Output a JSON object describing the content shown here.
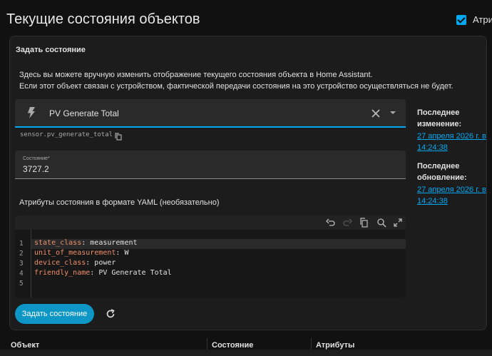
{
  "page": {
    "title": "Текущие состояния объектов",
    "attributes_toggle_label": "Атриб"
  },
  "card": {
    "title": "Задать состояние",
    "description_line1": "Здесь вы можете вручную изменить отображение текущего состояния объекта в Home Assistant.",
    "description_line2": "Если этот объект связан с устройством, фактической передачи состояния на это устройство осуществляться не будет."
  },
  "entity_picker": {
    "value": "PV Generate Total",
    "icon": "lightning-bolt-icon"
  },
  "entity_id": "sensor.pv_generate_total",
  "state_field": {
    "label": "Состояние*",
    "value": "3727.2"
  },
  "yaml": {
    "label": "Атрибуты состояния в формате YAML (необязательно)",
    "lines": [
      {
        "num": "1",
        "key": "state_class",
        "value": "measurement"
      },
      {
        "num": "2",
        "key": "unit_of_measurement",
        "value": "W"
      },
      {
        "num": "3",
        "key": "device_class",
        "value": "power"
      },
      {
        "num": "4",
        "key": "friendly_name",
        "value": "PV Generate Total"
      },
      {
        "num": "5",
        "key": "",
        "value": ""
      }
    ],
    "toolbar_icons": [
      "undo-icon",
      "redo-icon",
      "copy-icon",
      "search-replace-icon",
      "fullscreen-icon"
    ]
  },
  "actions": {
    "submit_label": "Задать состояние"
  },
  "side_info": {
    "last_changed_label": "Последнее изменение:",
    "last_changed_value": "27 апреля 2026 г. в 14:24:38",
    "last_updated_label": "Последнее обновление:",
    "last_updated_value": "27 апреля 2026 г. в 14:24:38"
  },
  "table": {
    "headers": [
      "Объект",
      "Состояние",
      "Атрибуты"
    ]
  },
  "colors": {
    "accent": "#03a9f4",
    "button": "#0d96c6",
    "yaml_key": "#ef8e6a"
  }
}
